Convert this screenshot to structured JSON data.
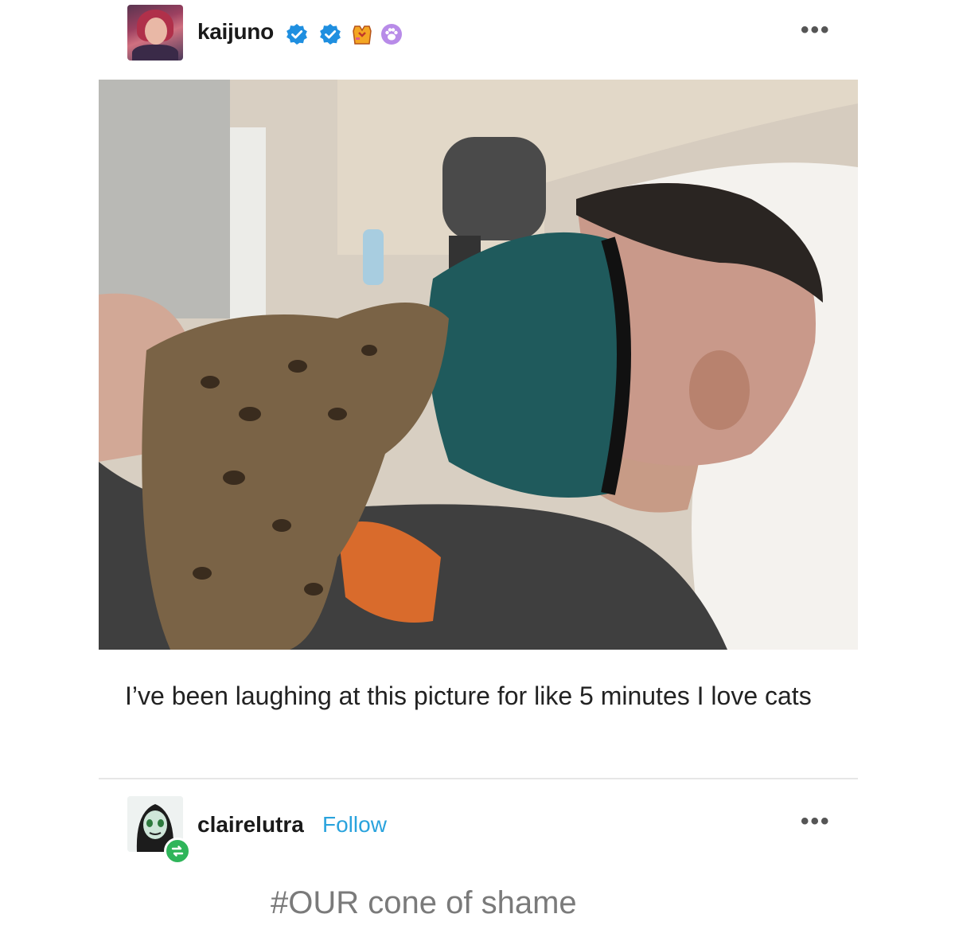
{
  "post": {
    "author": {
      "username": "kaijuno",
      "avatar_icon": "avatar-portrait-icon"
    },
    "badges": [
      "verified-badge-blue-icon",
      "verified-badge-blue-icon",
      "vest-badge-icon",
      "paw-badge-icon"
    ],
    "more_icon": "ellipsis-icon",
    "photo": {
      "subject": "cat-and-man-with-cone-photo"
    },
    "caption": "I’ve been laughing at this picture for like 5 minutes I love cats"
  },
  "reblog": {
    "username": "clairelutra",
    "follow_label": "Follow",
    "reblog_icon": "reblog-icon",
    "more_icon": "ellipsis-icon",
    "tag": "#OUR cone of shame"
  },
  "colors": {
    "follow": "#2aa3dd",
    "verified": "#1f8fe0",
    "reblog": "#2fb55a",
    "tag": "#7a7a7a"
  }
}
